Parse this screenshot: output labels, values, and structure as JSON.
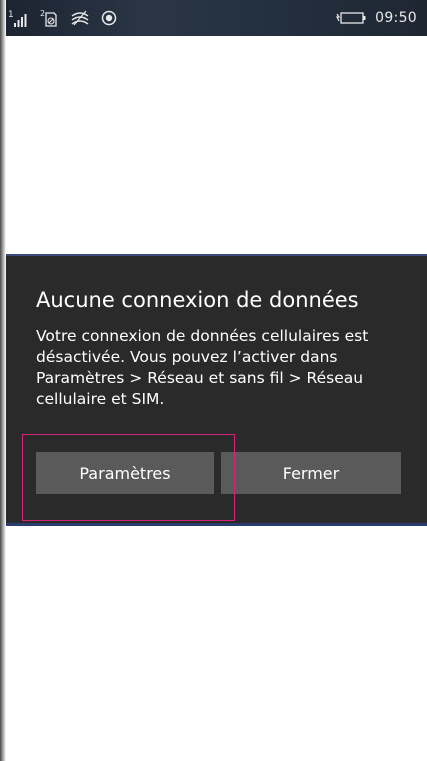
{
  "status_bar": {
    "sim_number": "1",
    "sim2_number": "2",
    "time": "09:50",
    "icons": [
      "signal-icon",
      "sim2-no-data-icon",
      "wifi-off-icon",
      "location-icon",
      "battery-charging-icon"
    ],
    "text_color": "#e8e8e8"
  },
  "dialog": {
    "title": "Aucune connexion de données",
    "message": "Votre connexion de données cellulaires est désactivée. Vous pouvez l’activer dans Paramètres > Réseau et sans fil > Réseau cellulaire et SIM.",
    "settings_button_label": "Paramètres",
    "close_button_label": "Fermer",
    "background": "#2a2a2a",
    "button_color": "#5a5a5a",
    "highlight_color": "#d4237a"
  }
}
